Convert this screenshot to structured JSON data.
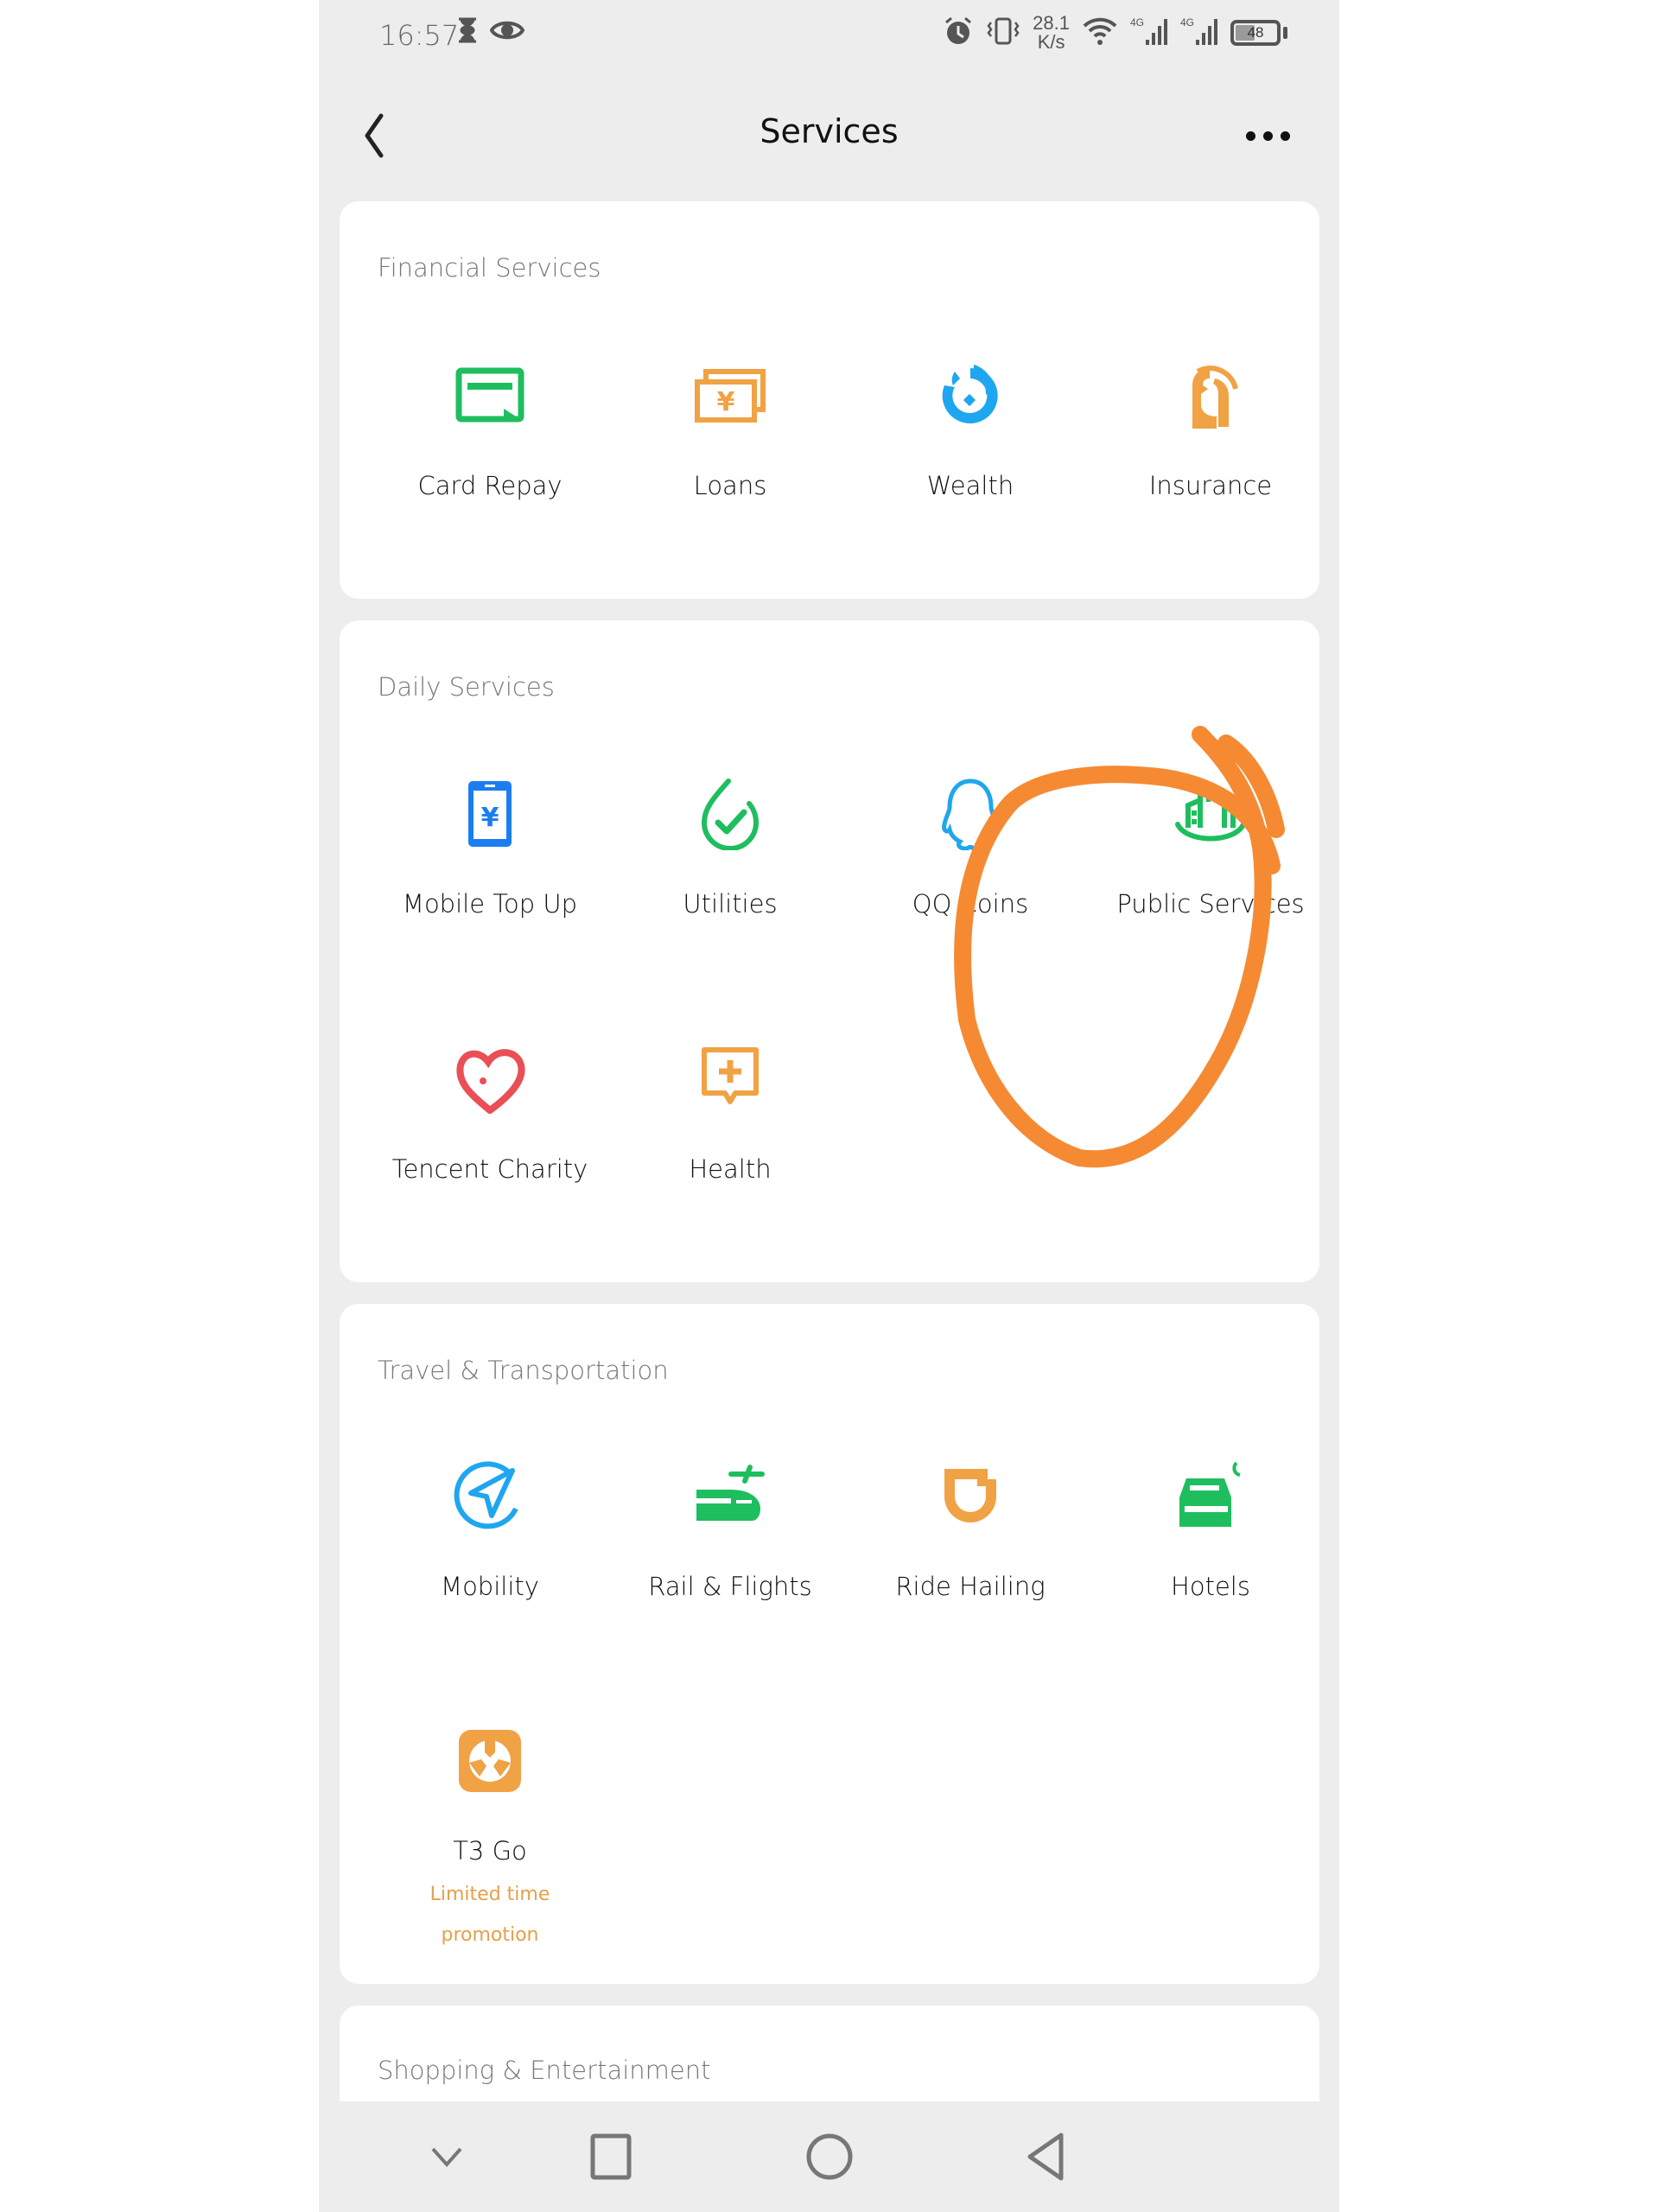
{
  "status_bar": {
    "time": "16:57",
    "left_icons": [
      "hourglass-icon",
      "eye-icon"
    ],
    "right_icons": [
      "alarm-icon",
      "vibrate-icon",
      "wifi-icon",
      "signal-4g-icon",
      "signal-4g-icon",
      "battery-icon"
    ],
    "network_speed_value": "28.1",
    "network_speed_unit": "K/s",
    "signal_label_1": "4G",
    "signal_label_2": "4G",
    "battery_percent": "48",
    "battery_level": 0.48
  },
  "header": {
    "title": "Services",
    "back_icon": "chevron-left-icon",
    "more_icon": "more-horizontal-icon"
  },
  "sections": [
    {
      "title": "Financial Services",
      "items": [
        {
          "label": "Card Repay",
          "icon": "card-repay-icon",
          "color": "#1ebe5f"
        },
        {
          "label": "Loans",
          "icon": "loans-icon",
          "color": "#f0a244"
        },
        {
          "label": "Wealth",
          "icon": "wealth-icon",
          "color": "#1fa6f0"
        },
        {
          "label": "Insurance",
          "icon": "insurance-icon",
          "color": "#f0a244"
        }
      ]
    },
    {
      "title": "Daily Services",
      "items": [
        {
          "label": "Mobile Top Up",
          "icon": "mobile-top-up-icon",
          "color": "#1b7ef0"
        },
        {
          "label": "Utilities",
          "icon": "utilities-icon",
          "color": "#1ebe5f"
        },
        {
          "label": "QQ Coins",
          "icon": "qq-coins-icon",
          "color": "#1fa6f0"
        },
        {
          "label": "Public Services",
          "icon": "public-services-icon",
          "color": "#1ebe5f",
          "highlighted": true
        },
        {
          "label": "Tencent Charity",
          "icon": "tencent-charity-icon",
          "color": "#e94f55"
        },
        {
          "label": "Health",
          "icon": "health-icon",
          "color": "#f0a244"
        }
      ]
    },
    {
      "title": "Travel & Transportation",
      "items": [
        {
          "label": "Mobility",
          "icon": "mobility-icon",
          "color": "#1fa6f0"
        },
        {
          "label": "Rail & Flights",
          "icon": "rail-flights-icon",
          "color": "#1ebe5f"
        },
        {
          "label": "Ride Hailing",
          "icon": "ride-hailing-icon",
          "color": "#f0a244"
        },
        {
          "label": "Hotels",
          "icon": "hotels-icon",
          "color": "#1ebe5f"
        },
        {
          "label": "T3 Go",
          "icon": "t3-go-icon",
          "color": "#f0a244",
          "promo_line1": "Limited time",
          "promo_line2": "promotion"
        }
      ]
    },
    {
      "title": "Shopping & Entertainment",
      "items": []
    }
  ],
  "nav_bar": {
    "buttons": [
      "collapse-icon",
      "recents-icon",
      "home-icon",
      "back-icon"
    ]
  },
  "annotation": {
    "color": "#f58a33",
    "target": "Public Services"
  }
}
